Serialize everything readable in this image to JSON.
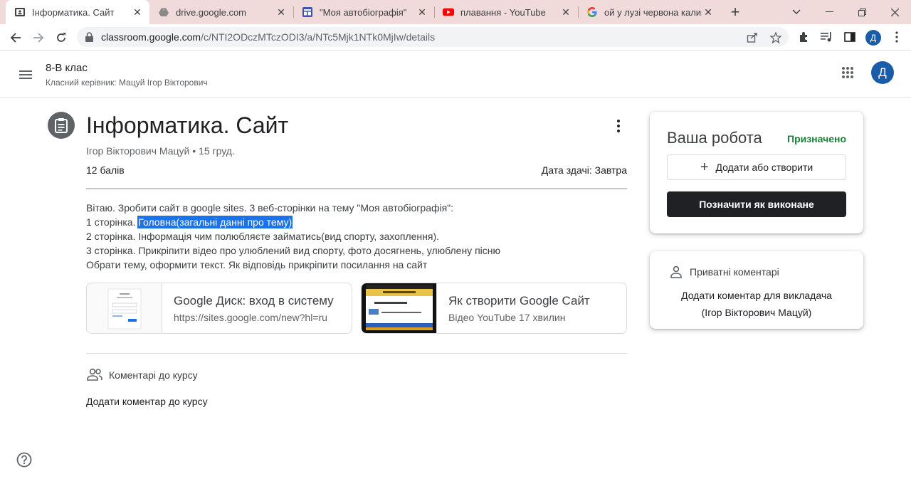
{
  "browser": {
    "tabs": [
      {
        "title": "Інформатика. Сайт",
        "icon": "classroom-icon",
        "active": true
      },
      {
        "title": "drive.google.com",
        "icon": "drive-icon",
        "active": false
      },
      {
        "title": "\"Моя автобіографія\"",
        "icon": "sites-icon",
        "active": false
      },
      {
        "title": "плавання - YouTube",
        "icon": "youtube-icon",
        "active": false
      },
      {
        "title": "ой у лузі червона калина",
        "icon": "google-icon",
        "active": false
      }
    ],
    "url_host": "classroom.google.com",
    "url_path": "/c/NTI2ODczMTczODI3/a/NTc5Mjk1NTk0MjIw/details",
    "profile_initial": "Д",
    "colors": {
      "tabstrip": "#f1dada",
      "accent": "#1a5ca8"
    }
  },
  "header": {
    "class_name": "8-В клас",
    "class_teacher": "Класний керівник: Мацуй Ігор Вікторович",
    "avatar_initial": "Д"
  },
  "assignment": {
    "title": "Інформатика. Сайт",
    "author_date": "Ігор Вікторович Мацуй • 15 груд.",
    "points": "12 балів",
    "due": "Дата здачі: Завтра",
    "description": {
      "line1": "Вітаю. Зробити сайт в google sites. 3 веб-сторінки на тему \"Моя автобіографія\":",
      "line2_prefix": "1 сторінка. ",
      "line2_highlight": "Головна(загальні данні про тему)",
      "line3": "2 сторінка. Інформація чим полюбляєте займатись(вид спорту, захоплення).",
      "line4": "3 сторінка. Прикріпити відео про  улюблений  вид спорту, фото досягнень, улюблену пісню",
      "line5": "Обрати тему, оформити текст. Як відповідь прикріпити посилання на сайт"
    },
    "attachments": [
      {
        "title": "Google Диск: вход в систему",
        "subtitle": "https://sites.google.com/new?hl=ru"
      },
      {
        "title": "Як створити Google Сайт",
        "subtitle": "Відео YouTube   17 хвилин"
      }
    ],
    "class_comments_label": "Коментарі до курсу",
    "add_class_comment": "Додати коментар до курсу"
  },
  "your_work": {
    "title": "Ваша робота",
    "status": "Призначено",
    "add_label": "Додати або створити",
    "mark_done_label": "Позначити як виконане",
    "status_color": "#188038"
  },
  "private_comments": {
    "label": "Приватні коментарі",
    "add_line1": "Додати коментар для викладача",
    "add_line2": "(Ігор Вікторович Мацуй)"
  }
}
